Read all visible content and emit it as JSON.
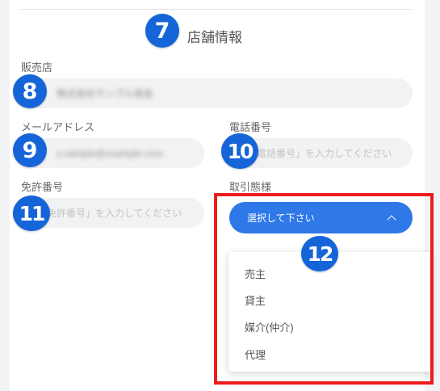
{
  "store_section": {
    "title": "店舗情報",
    "step_marker": "7"
  },
  "fields": {
    "dealer": {
      "label": "販売店",
      "marker": "8",
      "value": "株式会社サンプル商会"
    },
    "email": {
      "label": "メールアドレス",
      "marker": "9",
      "value": "s.sample@example.com"
    },
    "phone": {
      "label": "電話番号",
      "marker": "10",
      "placeholder": "「電話番号」を入力してください"
    },
    "license": {
      "label": "免許番号",
      "marker": "11",
      "placeholder": "「免許番号」を入力してください"
    },
    "transaction_type": {
      "label": "取引態様",
      "marker": "12",
      "select_label": "選択して下さい",
      "options": [
        "売主",
        "貸主",
        "媒介(仲介)",
        "代理"
      ]
    }
  },
  "colors": {
    "marker": "#1565d8",
    "select_button": "#2e78e8",
    "highlight": "#ec1c1c",
    "input_bg": "#f1f2f4"
  }
}
